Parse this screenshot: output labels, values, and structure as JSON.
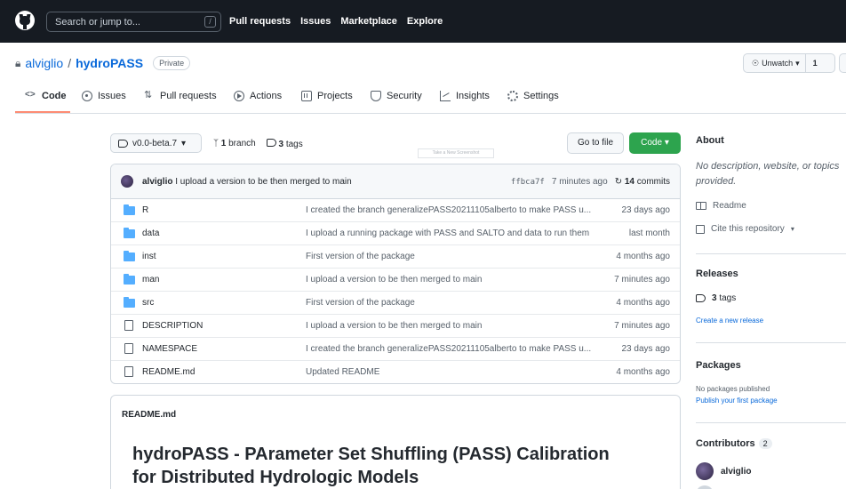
{
  "header": {
    "search_placeholder": "Search or jump to...",
    "search_key": "/",
    "nav": [
      "Pull requests",
      "Issues",
      "Marketplace",
      "Explore"
    ]
  },
  "repo": {
    "owner": "alviglio",
    "separator": "/",
    "name": "hydroPASS",
    "visibility": "Private",
    "watch_label": "Unwatch",
    "watch_count": "1"
  },
  "tabs": [
    {
      "label": "Code",
      "icon": "code-icon"
    },
    {
      "label": "Issues",
      "icon": "issue-icon"
    },
    {
      "label": "Pull requests",
      "icon": "pull-request-icon"
    },
    {
      "label": "Actions",
      "icon": "play-icon"
    },
    {
      "label": "Projects",
      "icon": "project-icon"
    },
    {
      "label": "Security",
      "icon": "shield-icon"
    },
    {
      "label": "Insights",
      "icon": "graph-icon"
    },
    {
      "label": "Settings",
      "icon": "gear-icon"
    }
  ],
  "toolbar": {
    "branch": "v0.0-beta.7",
    "branch_count": "1",
    "branch_word": "branch",
    "tag_count": "3",
    "tag_word": "tags",
    "overlay_text": "Take a New Screenshot",
    "go_to_file": "Go to file",
    "code_button": "Code"
  },
  "latest_commit": {
    "author": "alviglio",
    "message": "I upload a version to be then merged to main",
    "sha": "ffbca7f",
    "age": "7 minutes ago",
    "commit_count": "14",
    "commit_word": "commits"
  },
  "files": [
    {
      "type": "dir",
      "name": "R",
      "message": "I created the branch generalizePASS20211105alberto to make PASS u...",
      "age": "23 days ago"
    },
    {
      "type": "dir",
      "name": "data",
      "message": "I upload a running package with PASS and SALTO and data to run them",
      "age": "last month"
    },
    {
      "type": "dir",
      "name": "inst",
      "message": "First version of the package",
      "age": "4 months ago"
    },
    {
      "type": "dir",
      "name": "man",
      "message": "I upload a version to be then merged to main",
      "age": "7 minutes ago"
    },
    {
      "type": "dir",
      "name": "src",
      "message": "First version of the package",
      "age": "4 months ago"
    },
    {
      "type": "file",
      "name": "DESCRIPTION",
      "message": "I upload a version to be then merged to main",
      "age": "7 minutes ago"
    },
    {
      "type": "file",
      "name": "NAMESPACE",
      "message": "I created the branch generalizePASS20211105alberto to make PASS u...",
      "age": "23 days ago"
    },
    {
      "type": "file",
      "name": "README.md",
      "message": "Updated README",
      "age": "4 months ago"
    }
  ],
  "readme": {
    "header": "README.md",
    "title": "hydroPASS - PArameter Set Shuffling (PASS) Calibration for Distributed Hydrologic Models"
  },
  "sidebar": {
    "about_title": "About",
    "about_desc_line1": "No description, website, or topics",
    "about_desc_line2": "provided.",
    "readme_link": "Readme",
    "cite_link": "Cite this repository",
    "releases_title": "Releases",
    "releases_tag_count": "3",
    "releases_tag_word": "tags",
    "create_release": "Create a new release",
    "packages_title": "Packages",
    "packages_none": "No packages published",
    "publish_package": "Publish your first package",
    "contributors_title": "Contributors",
    "contributors_count": "2",
    "contributor_1": "alviglio"
  },
  "colors": {
    "header_bg": "#161b22",
    "accent_green": "#2da44e",
    "link_blue": "#0969da",
    "folder_blue": "#54aeff",
    "active_tab_underline": "#fd8c73"
  }
}
